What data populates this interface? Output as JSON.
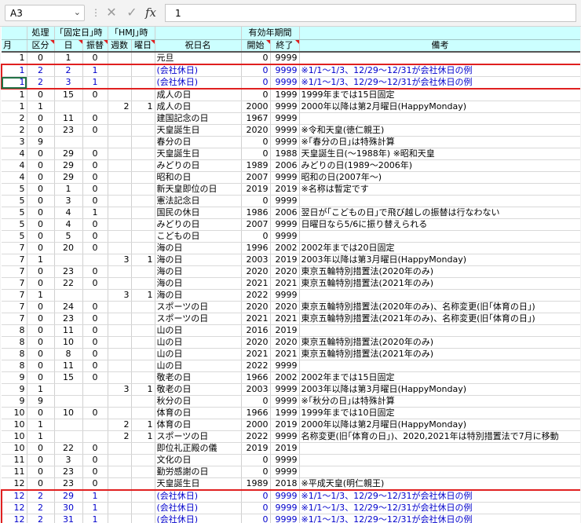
{
  "formula_bar": {
    "namebox": "A3",
    "cancel_icon": "✕",
    "enter_icon": "✓",
    "fx_label": "fx",
    "value": "1"
  },
  "header": {
    "row1": {
      "processing": "処理",
      "fixed_day": "｢固定日｣時",
      "hmj": "｢HMJ｣時",
      "valid_period": "有効年期間"
    },
    "row2": {
      "month": "月",
      "kubun": "区分",
      "day": "日",
      "furikae": "振替",
      "weeks": "週数",
      "weekday": "曜日",
      "holiday_name": "祝日名",
      "start": "開始",
      "end": "終了",
      "notes": "備考"
    }
  },
  "rows": [
    {
      "m": "1",
      "k": "0",
      "d": "1",
      "f": "0",
      "w": "",
      "wd": "",
      "name": "元旦",
      "s": "0",
      "e": "9999",
      "note": ""
    },
    {
      "m": "1",
      "k": "2",
      "d": "2",
      "f": "1",
      "w": "",
      "wd": "",
      "name": "(会社休日)",
      "s": "0",
      "e": "9999",
      "note": "※1/1～1/3、12/29～12/31が会社休日の例"
    },
    {
      "m": "1",
      "k": "2",
      "d": "3",
      "f": "1",
      "w": "",
      "wd": "",
      "name": "(会社休日)",
      "s": "0",
      "e": "9999",
      "note": "※1/1～1/3、12/29～12/31が会社休日の例"
    },
    {
      "m": "1",
      "k": "0",
      "d": "15",
      "f": "0",
      "w": "",
      "wd": "",
      "name": "成人の日",
      "s": "0",
      "e": "1999",
      "note": "1999年までは15日固定"
    },
    {
      "m": "1",
      "k": "1",
      "d": "",
      "f": "",
      "w": "2",
      "wd": "1",
      "name": "成人の日",
      "s": "2000",
      "e": "9999",
      "note": "2000年以降は第2月曜日(HappyMonday)"
    },
    {
      "m": "2",
      "k": "0",
      "d": "11",
      "f": "0",
      "w": "",
      "wd": "",
      "name": "建国記念の日",
      "s": "1967",
      "e": "9999",
      "note": ""
    },
    {
      "m": "2",
      "k": "0",
      "d": "23",
      "f": "0",
      "w": "",
      "wd": "",
      "name": "天皇誕生日",
      "s": "2020",
      "e": "9999",
      "note": "※令和天皇(徳仁親王)"
    },
    {
      "m": "3",
      "k": "9",
      "d": "",
      "f": "",
      "w": "",
      "wd": "",
      "name": "春分の日",
      "s": "0",
      "e": "9999",
      "note": "※｢春分の日｣は特殊計算"
    },
    {
      "m": "4",
      "k": "0",
      "d": "29",
      "f": "0",
      "w": "",
      "wd": "",
      "name": "天皇誕生日",
      "s": "0",
      "e": "1988",
      "note": "天皇誕生日(～1988年) ※昭和天皇"
    },
    {
      "m": "4",
      "k": "0",
      "d": "29",
      "f": "0",
      "w": "",
      "wd": "",
      "name": "みどりの日",
      "s": "1989",
      "e": "2006",
      "note": "みどりの日(1989～2006年)"
    },
    {
      "m": "4",
      "k": "0",
      "d": "29",
      "f": "0",
      "w": "",
      "wd": "",
      "name": "昭和の日",
      "s": "2007",
      "e": "9999",
      "note": "昭和の日(2007年～)"
    },
    {
      "m": "5",
      "k": "0",
      "d": "1",
      "f": "0",
      "w": "",
      "wd": "",
      "name": "新天皇即位の日",
      "s": "2019",
      "e": "2019",
      "note": "※名称は暫定です"
    },
    {
      "m": "5",
      "k": "0",
      "d": "3",
      "f": "0",
      "w": "",
      "wd": "",
      "name": "憲法記念日",
      "s": "0",
      "e": "9999",
      "note": ""
    },
    {
      "m": "5",
      "k": "0",
      "d": "4",
      "f": "1",
      "w": "",
      "wd": "",
      "name": "国民の休日",
      "s": "1986",
      "e": "2006",
      "note": "翌日が｢こどもの日｣で飛び越しの振替は行なわない"
    },
    {
      "m": "5",
      "k": "0",
      "d": "4",
      "f": "0",
      "w": "",
      "wd": "",
      "name": "みどりの日",
      "s": "2007",
      "e": "9999",
      "note": "日曜日なら5/6に振り替えられる"
    },
    {
      "m": "5",
      "k": "0",
      "d": "5",
      "f": "0",
      "w": "",
      "wd": "",
      "name": "こどもの日",
      "s": "0",
      "e": "9999",
      "note": ""
    },
    {
      "m": "7",
      "k": "0",
      "d": "20",
      "f": "0",
      "w": "",
      "wd": "",
      "name": "海の日",
      "s": "1996",
      "e": "2002",
      "note": "2002年までは20日固定"
    },
    {
      "m": "7",
      "k": "1",
      "d": "",
      "f": "",
      "w": "3",
      "wd": "1",
      "name": "海の日",
      "s": "2003",
      "e": "2019",
      "note": "2003年以降は第3月曜日(HappyMonday)"
    },
    {
      "m": "7",
      "k": "0",
      "d": "23",
      "f": "0",
      "w": "",
      "wd": "",
      "name": "海の日",
      "s": "2020",
      "e": "2020",
      "note": "東京五輪特別措置法(2020年のみ)"
    },
    {
      "m": "7",
      "k": "0",
      "d": "22",
      "f": "0",
      "w": "",
      "wd": "",
      "name": "海の日",
      "s": "2021",
      "e": "2021",
      "note": "東京五輪特別措置法(2021年のみ)"
    },
    {
      "m": "7",
      "k": "1",
      "d": "",
      "f": "",
      "w": "3",
      "wd": "1",
      "name": "海の日",
      "s": "2022",
      "e": "9999",
      "note": ""
    },
    {
      "m": "7",
      "k": "0",
      "d": "24",
      "f": "0",
      "w": "",
      "wd": "",
      "name": "スポーツの日",
      "s": "2020",
      "e": "2020",
      "note": "東京五輪特別措置法(2020年のみ)、名称変更(旧｢体育の日｣)"
    },
    {
      "m": "7",
      "k": "0",
      "d": "23",
      "f": "0",
      "w": "",
      "wd": "",
      "name": "スポーツの日",
      "s": "2021",
      "e": "2021",
      "note": "東京五輪特別措置法(2021年のみ)、名称変更(旧｢体育の日｣)"
    },
    {
      "m": "8",
      "k": "0",
      "d": "11",
      "f": "0",
      "w": "",
      "wd": "",
      "name": "山の日",
      "s": "2016",
      "e": "2019",
      "note": ""
    },
    {
      "m": "8",
      "k": "0",
      "d": "10",
      "f": "0",
      "w": "",
      "wd": "",
      "name": "山の日",
      "s": "2020",
      "e": "2020",
      "note": "東京五輪特別措置法(2020年のみ)"
    },
    {
      "m": "8",
      "k": "0",
      "d": "8",
      "f": "0",
      "w": "",
      "wd": "",
      "name": "山の日",
      "s": "2021",
      "e": "2021",
      "note": "東京五輪特別措置法(2021年のみ)"
    },
    {
      "m": "8",
      "k": "0",
      "d": "11",
      "f": "0",
      "w": "",
      "wd": "",
      "name": "山の日",
      "s": "2022",
      "e": "9999",
      "note": ""
    },
    {
      "m": "9",
      "k": "0",
      "d": "15",
      "f": "0",
      "w": "",
      "wd": "",
      "name": "敬老の日",
      "s": "1966",
      "e": "2002",
      "note": "2002年までは15日固定"
    },
    {
      "m": "9",
      "k": "1",
      "d": "",
      "f": "",
      "w": "3",
      "wd": "1",
      "name": "敬老の日",
      "s": "2003",
      "e": "9999",
      "note": "2003年以降は第3月曜日(HappyMonday)"
    },
    {
      "m": "9",
      "k": "9",
      "d": "",
      "f": "",
      "w": "",
      "wd": "",
      "name": "秋分の日",
      "s": "0",
      "e": "9999",
      "note": "※｢秋分の日｣は特殊計算"
    },
    {
      "m": "10",
      "k": "0",
      "d": "10",
      "f": "0",
      "w": "",
      "wd": "",
      "name": "体育の日",
      "s": "1966",
      "e": "1999",
      "note": "1999年までは10日固定"
    },
    {
      "m": "10",
      "k": "1",
      "d": "",
      "f": "",
      "w": "2",
      "wd": "1",
      "name": "体育の日",
      "s": "2000",
      "e": "2019",
      "note": "2000年以降は第2月曜日(HappyMonday)"
    },
    {
      "m": "10",
      "k": "1",
      "d": "",
      "f": "",
      "w": "2",
      "wd": "1",
      "name": "スポーツの日",
      "s": "2022",
      "e": "9999",
      "note": "名称変更(旧｢体育の日｣)、2020,2021年は特別措置法で7月に移動"
    },
    {
      "m": "10",
      "k": "0",
      "d": "22",
      "f": "0",
      "w": "",
      "wd": "",
      "name": "即位礼正殿の儀",
      "s": "2019",
      "e": "2019",
      "note": ""
    },
    {
      "m": "11",
      "k": "0",
      "d": "3",
      "f": "0",
      "w": "",
      "wd": "",
      "name": "文化の日",
      "s": "0",
      "e": "9999",
      "note": ""
    },
    {
      "m": "11",
      "k": "0",
      "d": "23",
      "f": "0",
      "w": "",
      "wd": "",
      "name": "勤労感謝の日",
      "s": "0",
      "e": "9999",
      "note": ""
    },
    {
      "m": "12",
      "k": "0",
      "d": "23",
      "f": "0",
      "w": "",
      "wd": "",
      "name": "天皇誕生日",
      "s": "1989",
      "e": "2018",
      "note": "※平成天皇(明仁親王)"
    },
    {
      "m": "12",
      "k": "2",
      "d": "29",
      "f": "1",
      "w": "",
      "wd": "",
      "name": "(会社休日)",
      "s": "0",
      "e": "9999",
      "note": "※1/1～1/3、12/29～12/31が会社休日の例"
    },
    {
      "m": "12",
      "k": "2",
      "d": "30",
      "f": "1",
      "w": "",
      "wd": "",
      "name": "(会社休日)",
      "s": "0",
      "e": "9999",
      "note": "※1/1～1/3、12/29～12/31が会社休日の例"
    },
    {
      "m": "12",
      "k": "2",
      "d": "31",
      "f": "1",
      "w": "",
      "wd": "",
      "name": "(会社休日)",
      "s": "0",
      "e": "9999",
      "note": "※1/1～1/3、12/29～12/31が会社休日の例"
    }
  ],
  "colors": {
    "header_bg": "#ccffff",
    "company_holiday_text": "#0000cc",
    "highlight_box": "#e02020"
  }
}
